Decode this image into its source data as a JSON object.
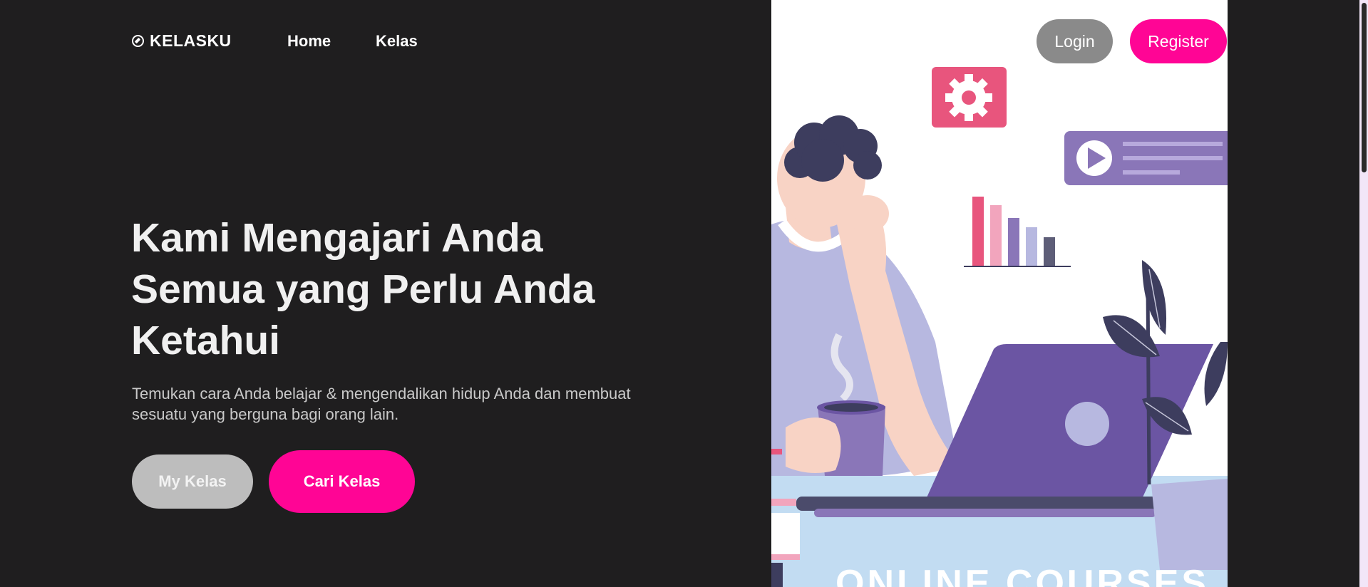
{
  "brand": {
    "name": "KELASKU",
    "icon": "compass-icon"
  },
  "nav": {
    "home": "Home",
    "kelas": "Kelas"
  },
  "auth": {
    "login": "Login",
    "register": "Register"
  },
  "hero": {
    "title_lines": [
      "Kami Mengajari Anda",
      "Semua yang Perlu Anda",
      "Ketahui"
    ],
    "subtitle_lines": [
      "Temukan cara Anda belajar & mengendalikan hidup Anda dan membuat",
      "sesuatu yang berguna bagi orang lain."
    ],
    "primary_button": "Cari Kelas",
    "secondary_button": "My Kelas"
  },
  "illustration": {
    "cut_off_caption": "ONLINE COURSES",
    "icons": [
      "gear-icon",
      "play-icon",
      "bar-chart-icon",
      "laptop-icon",
      "plant-icon",
      "coffee-cup-icon"
    ]
  },
  "colors": {
    "background": "#1f1e1f",
    "accent": "#ff0595",
    "login_button": "#8a8a8a",
    "secondary_button": "#bdbdbd",
    "illustration_purple": "#6b55a3",
    "illustration_pink": "#e8557d"
  }
}
